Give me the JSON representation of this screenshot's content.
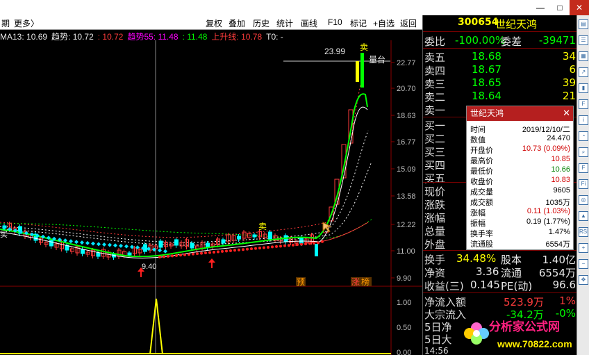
{
  "toolbar": {
    "left_label": "期",
    "more_label": "更多〉",
    "buttons": [
      "复权",
      "叠加",
      "历史",
      "统计",
      "画线",
      "F10",
      "标记",
      "+自选",
      "返回"
    ]
  },
  "window_controls": {
    "min": "—",
    "max": "□",
    "close": "✕"
  },
  "indicator_line": [
    {
      "text": "MA13: 10.69",
      "color": "#e8e8e8"
    },
    {
      "text": "趋势: 10.72",
      "color": "#e8e8e8"
    },
    {
      "text": ": 10.72",
      "color": "#ff3c3c"
    },
    {
      "text": "趋势55: 11.48",
      "color": "#ff00ff"
    },
    {
      "text": ": 11.48",
      "color": "#00ff00"
    },
    {
      "text": "上升线: 10.78",
      "color": "#ff3c3c"
    },
    {
      "text": "T0: -",
      "color": "#e8e8e8"
    }
  ],
  "chart": {
    "y_ticks": [
      "22.77",
      "20.70",
      "18.63",
      "16.77",
      "15.09",
      "13.58",
      "12.22",
      "11.00",
      "9.90"
    ],
    "high_label": "23.99",
    "platform_label": "量台",
    "low_label": "9.40",
    "sell_marker": "卖",
    "buy_marker": "买",
    "pre_label": "预",
    "zhangting_label": "涨",
    "zhangting_label2": "榜",
    "vol_ticks": [
      "1.00",
      "0.50",
      "0.00"
    ],
    "colors": {
      "up": "#ff3c3c",
      "down": "#00ffff",
      "ma_green": "#00ff00",
      "ma_white": "#ffffff",
      "ma_yellow": "#ffff00",
      "ma_dot": "#00e5ff"
    }
  },
  "panel": {
    "code": "300654",
    "name": "世纪天鸿",
    "weibi_label": "委比",
    "weibi": "-100.00%",
    "weicha_label": "委差",
    "weicha": "-39471",
    "asks": [
      {
        "label": "卖五",
        "price": "18.68",
        "vol": "34"
      },
      {
        "label": "卖四",
        "price": "18.67",
        "vol": "6"
      },
      {
        "label": "卖三",
        "price": "18.65",
        "vol": "39"
      },
      {
        "label": "卖二",
        "price": "18.64",
        "vol": "21"
      },
      {
        "label": "卖一",
        "price": "",
        "vol": ""
      }
    ],
    "bids": [
      "买一",
      "买二",
      "买三",
      "买四",
      "买五"
    ],
    "stats_left": [
      "现价",
      "涨跌",
      "涨幅",
      "总量",
      "外盘"
    ],
    "turnover_label": "换手",
    "turnover": "34.48%",
    "equity_label": "股本",
    "equity": "1.40亿",
    "nav_label": "净资",
    "nav": "3.36",
    "float_label": "流通",
    "float": "6554万",
    "eps_label": "收益(三)",
    "eps": "0.145",
    "pe_label": "PE(动)",
    "pe": "96.6",
    "netflow_label": "净流入额",
    "netflow": "523.9万",
    "netflow_pct": "1%",
    "block_label": "大宗流入",
    "block": "-34.2万",
    "block_pct": "-0%",
    "net5_label": "5日净",
    "big5_label": "5日大",
    "time_label": "14:56"
  },
  "popup": {
    "title": "世纪天鸿",
    "close": "✕",
    "rows": [
      {
        "k": "时间",
        "v": "2019/12/10/二",
        "c": "#000"
      },
      {
        "k": "数值",
        "v": "24.470",
        "c": "#000"
      },
      {
        "k": "开盘价",
        "v": "10.73 (0.09%)",
        "c": "#d00000"
      },
      {
        "k": "最高价",
        "v": "10.85",
        "c": "#d00000"
      },
      {
        "k": "最低价",
        "v": "10.66",
        "c": "#008000"
      },
      {
        "k": "收盘价",
        "v": "10.83",
        "c": "#d00000"
      },
      {
        "k": "成交量",
        "v": "9605",
        "c": "#000"
      },
      {
        "k": "成交额",
        "v": "1035万",
        "c": "#000"
      },
      {
        "k": "涨幅",
        "v": "0.11 (1.03%)",
        "c": "#d00000"
      },
      {
        "k": "振幅",
        "v": "0.19 (1.77%)",
        "c": "#000"
      },
      {
        "k": "换手率",
        "v": "1.47%",
        "c": "#000"
      },
      {
        "k": "流通股",
        "v": "6554万",
        "c": "#000"
      }
    ]
  },
  "sidebar_icons": [
    "chart-icon",
    "list-icon",
    "grid-icon",
    "trend-icon",
    "bars-icon",
    "f10-icon",
    "info-icon",
    "pie-icon",
    "search-icon",
    "f-icon",
    "fig-icon",
    "zoom-icon",
    "up-icon",
    "rsi-icon",
    "zoom-in-icon",
    "zoom-out-icon",
    "move-icon"
  ],
  "sidebar_glyphs": [
    "▤",
    "☰",
    "▦",
    "↗",
    "▮",
    "F",
    "i",
    "◔",
    "⌕",
    "F",
    "Fi",
    "◎",
    "▲",
    "RSI",
    "+",
    "−",
    "✥"
  ],
  "watermark": {
    "text": "分析家公式网",
    "url": "www.70822.com"
  }
}
